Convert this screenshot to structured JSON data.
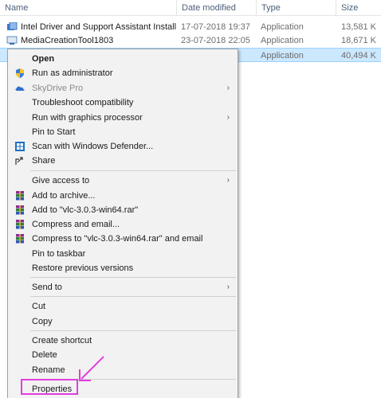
{
  "header": {
    "name": "Name",
    "date": "Date modified",
    "type": "Type",
    "size": "Size"
  },
  "files": [
    {
      "name": "Intel Driver and Support Assistant Installer",
      "date": "17-07-2018 19:37",
      "type": "Application",
      "size": "13,581 K",
      "icon": "installer-icon"
    },
    {
      "name": "MediaCreationTool1803",
      "date": "23-07-2018 22:05",
      "type": "Application",
      "size": "18,671 K",
      "icon": "media-creation-icon"
    },
    {
      "name": "",
      "date": "",
      "type": "Application",
      "size": "40,494 K",
      "icon": ""
    }
  ],
  "menu": {
    "open": "Open",
    "run_as_admin": "Run as administrator",
    "skydrive_pro": "SkyDrive Pro",
    "troubleshoot": "Troubleshoot compatibility",
    "run_with_gpu": "Run with graphics processor",
    "pin_to_start": "Pin to Start",
    "scan_defender": "Scan with Windows Defender...",
    "share": "Share",
    "give_access": "Give access to",
    "add_to_archive": "Add to archive...",
    "add_to_rar": "Add to \"vlc-3.0.3-win64.rar\"",
    "compress_email": "Compress and email...",
    "compress_rar_email": "Compress to \"vlc-3.0.3-win64.rar\" and email",
    "pin_to_taskbar": "Pin to taskbar",
    "restore_versions": "Restore previous versions",
    "send_to": "Send to",
    "cut": "Cut",
    "copy": "Copy",
    "create_shortcut": "Create shortcut",
    "delete": "Delete",
    "rename": "Rename",
    "properties": "Properties",
    "submenu_arrow": "›"
  },
  "colors": {
    "highlight_annotation": "#e23ddf",
    "selection": "#cce8ff"
  }
}
